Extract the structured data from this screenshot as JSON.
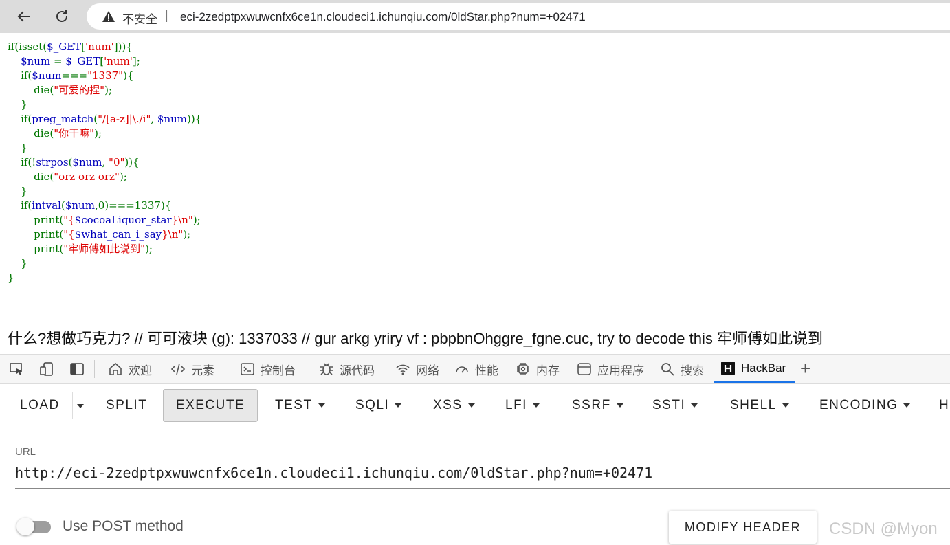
{
  "browser": {
    "insecure_label": "不安全",
    "separator": "|",
    "url": "eci-2zedptpxwuwcnfx6ce1n.cloudeci1.ichunqiu.com/0ldStar.php?num=+02471"
  },
  "source_code": {
    "lines": [
      [
        {
          "t": "kw",
          "v": "if(isset("
        },
        {
          "t": "vr",
          "v": "$_GET"
        },
        {
          "t": "kw",
          "v": "["
        },
        {
          "t": "st",
          "v": "'num'"
        },
        {
          "t": "kw",
          "v": "])){"
        }
      ],
      [
        {
          "t": "kw",
          "v": "    "
        },
        {
          "t": "vr",
          "v": "$num"
        },
        {
          "t": "kw",
          "v": " = "
        },
        {
          "t": "vr",
          "v": "$_GET"
        },
        {
          "t": "kw",
          "v": "["
        },
        {
          "t": "st",
          "v": "'num'"
        },
        {
          "t": "kw",
          "v": "];"
        }
      ],
      [
        {
          "t": "kw",
          "v": "    if("
        },
        {
          "t": "vr",
          "v": "$num"
        },
        {
          "t": "kw",
          "v": "==="
        },
        {
          "t": "st",
          "v": "\"1337\""
        },
        {
          "t": "kw",
          "v": "){"
        }
      ],
      [
        {
          "t": "kw",
          "v": "        die("
        },
        {
          "t": "st",
          "v": "\"可爱的捏\""
        },
        {
          "t": "kw",
          "v": ");"
        }
      ],
      [
        {
          "t": "kw",
          "v": "    }"
        }
      ],
      [
        {
          "t": "kw",
          "v": "    if("
        },
        {
          "t": "vr",
          "v": "preg_match"
        },
        {
          "t": "kw",
          "v": "("
        },
        {
          "t": "st",
          "v": "\"/[a-z]|\\./i\""
        },
        {
          "t": "kw",
          "v": ", "
        },
        {
          "t": "vr",
          "v": "$num"
        },
        {
          "t": "kw",
          "v": ")){"
        }
      ],
      [
        {
          "t": "kw",
          "v": "        die("
        },
        {
          "t": "st",
          "v": "\"你干嘛\""
        },
        {
          "t": "kw",
          "v": ");"
        }
      ],
      [
        {
          "t": "kw",
          "v": "    }"
        }
      ],
      [
        {
          "t": "kw",
          "v": "    if(!"
        },
        {
          "t": "vr",
          "v": "strpos"
        },
        {
          "t": "kw",
          "v": "("
        },
        {
          "t": "vr",
          "v": "$num"
        },
        {
          "t": "kw",
          "v": ", "
        },
        {
          "t": "st",
          "v": "\"0\""
        },
        {
          "t": "kw",
          "v": ")){"
        }
      ],
      [
        {
          "t": "kw",
          "v": "        die("
        },
        {
          "t": "st",
          "v": "\"orz orz orz\""
        },
        {
          "t": "kw",
          "v": ");"
        }
      ],
      [
        {
          "t": "kw",
          "v": "    }"
        }
      ],
      [
        {
          "t": "kw",
          "v": "    if("
        },
        {
          "t": "vr",
          "v": "intval"
        },
        {
          "t": "kw",
          "v": "("
        },
        {
          "t": "vr",
          "v": "$num"
        },
        {
          "t": "kw",
          "v": ",0)===1337){"
        }
      ],
      [
        {
          "t": "kw",
          "v": "        print("
        },
        {
          "t": "st",
          "v": "\"{"
        },
        {
          "t": "vr",
          "v": "$cocoaLiquor_star"
        },
        {
          "t": "st",
          "v": "}\\n\""
        },
        {
          "t": "kw",
          "v": ");"
        }
      ],
      [
        {
          "t": "kw",
          "v": "        print("
        },
        {
          "t": "st",
          "v": "\"{"
        },
        {
          "t": "vr",
          "v": "$what_can_i_say"
        },
        {
          "t": "st",
          "v": "}\\n\""
        },
        {
          "t": "kw",
          "v": ");"
        }
      ],
      [
        {
          "t": "kw",
          "v": "        print("
        },
        {
          "t": "st",
          "v": "\"牢师傅如此说到\""
        },
        {
          "t": "kw",
          "v": ");"
        }
      ],
      [
        {
          "t": "kw",
          "v": "    }"
        }
      ],
      [
        {
          "t": "kw",
          "v": "}"
        }
      ]
    ]
  },
  "output_text": "什么?想做巧克力? // 可可液块 (g): 1337033 // gur arkg yriry vf : pbpbnOhggre_fgne.cuc, try to decode this 牢师傅如此说到",
  "devtools": {
    "tabs": [
      {
        "label": "欢迎",
        "icon": "home-icon"
      },
      {
        "label": "元素",
        "icon": "code-icon"
      },
      {
        "label": "控制台",
        "icon": "console-icon"
      },
      {
        "label": "源代码",
        "icon": "bug-icon"
      },
      {
        "label": "网络",
        "icon": "wifi-icon"
      },
      {
        "label": "性能",
        "icon": "gauge-icon"
      },
      {
        "label": "内存",
        "icon": "chip-icon"
      },
      {
        "label": "应用程序",
        "icon": "app-icon"
      },
      {
        "label": "搜索",
        "icon": "search-icon"
      },
      {
        "label": "HackBar",
        "icon": "hackbar-logo-icon",
        "active": true
      }
    ],
    "add_tab": "+"
  },
  "hackbar": {
    "buttons": [
      "LOAD",
      "SPLIT",
      "EXECUTE",
      "TEST",
      "SQLI",
      "XSS",
      "LFI",
      "SSRF",
      "SSTI",
      "SHELL",
      "ENCODING",
      "H"
    ],
    "url_label": "URL",
    "url_value": "http://eci-2zedptpxwuwcnfx6ce1n.cloudeci1.ichunqiu.com/0ldStar.php?num=+02471",
    "post_toggle_label": "Use POST method",
    "post_enabled": false,
    "modify_header": "MODIFY HEADER"
  },
  "watermark": "CSDN @Myon"
}
